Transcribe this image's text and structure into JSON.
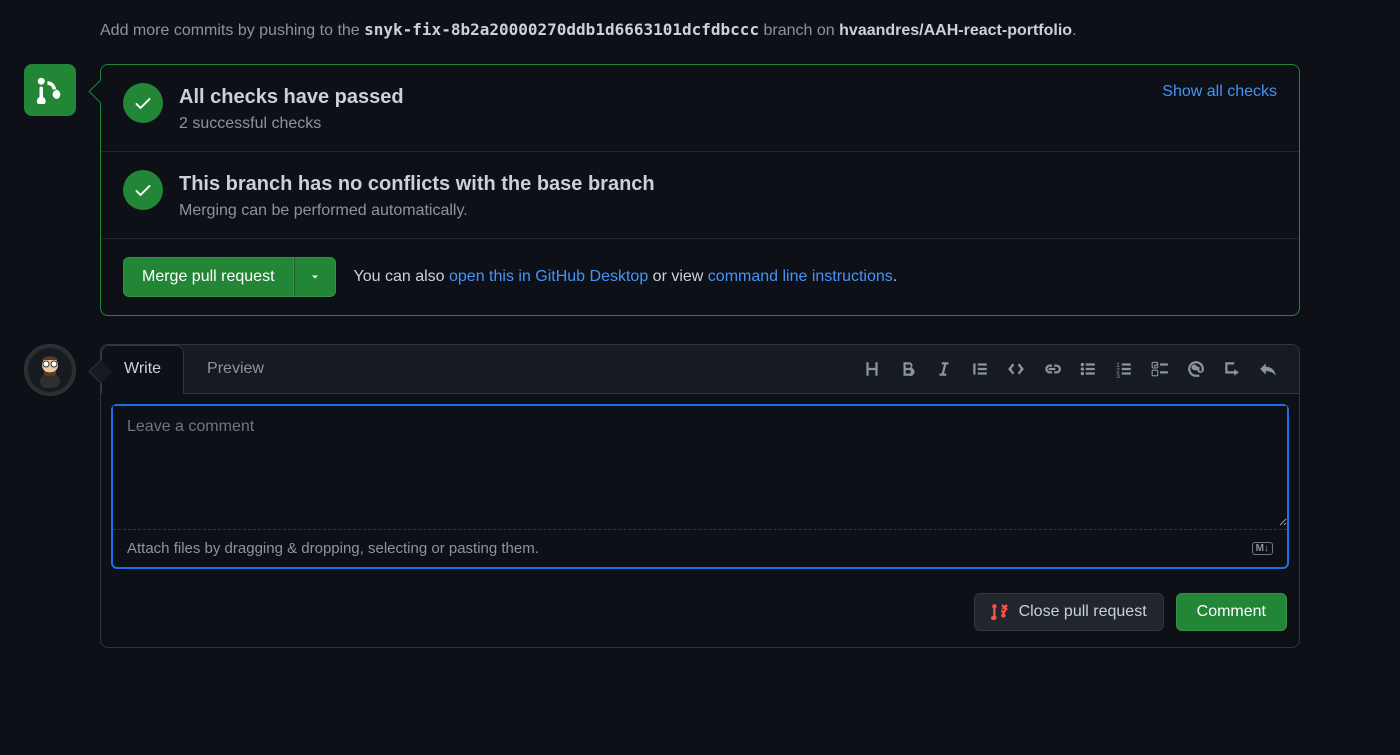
{
  "hint": {
    "prefix": "Add more commits by pushing to the ",
    "branch": "snyk-fix-8b2a20000270ddb1d6663101dcfdbccc",
    "mid": " branch on ",
    "repo": "hvaandres/AAH-react-portfolio",
    "suffix": "."
  },
  "merge_panel": {
    "checks": {
      "title": "All checks have passed",
      "subtitle": "2 successful checks",
      "show_all": "Show all checks"
    },
    "conflicts": {
      "title": "This branch has no conflicts with the base branch",
      "subtitle": "Merging can be performed automatically."
    },
    "merge_button": "Merge pull request",
    "help": {
      "prefix": "You can also ",
      "desktop_link": "open this in GitHub Desktop",
      "mid": " or view ",
      "cli_link": "command line instructions",
      "suffix": "."
    }
  },
  "comment": {
    "tabs": {
      "write": "Write",
      "preview": "Preview"
    },
    "placeholder": "Leave a comment",
    "attach_hint": "Attach files by dragging & dropping, selecting or pasting them.",
    "md_badge": "M↓",
    "close_button": "Close pull request",
    "comment_button": "Comment"
  }
}
